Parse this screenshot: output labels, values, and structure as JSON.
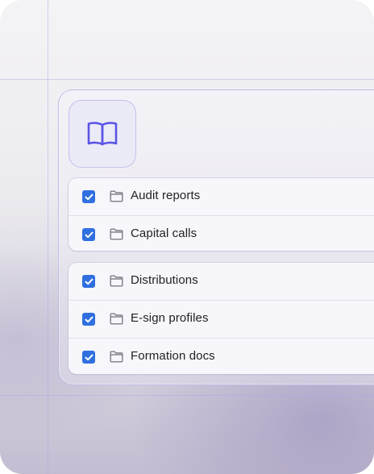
{
  "panel": {
    "icon": "book-icon",
    "groups": [
      {
        "items": [
          {
            "label": "Audit reports",
            "checked": true,
            "icon": "folder-icon"
          },
          {
            "label": "Capital calls",
            "checked": true,
            "icon": "folder-icon"
          }
        ]
      },
      {
        "items": [
          {
            "label": "Distributions",
            "checked": true,
            "icon": "folder-icon"
          },
          {
            "label": "E-sign profiles",
            "checked": true,
            "icon": "folder-icon"
          },
          {
            "label": "Formation docs",
            "checked": true,
            "icon": "folder-icon"
          }
        ]
      }
    ]
  },
  "colors": {
    "accent": "#5b55e6",
    "checkbox": "#2f6fe0",
    "guide_lines": "#aaa5e6"
  }
}
